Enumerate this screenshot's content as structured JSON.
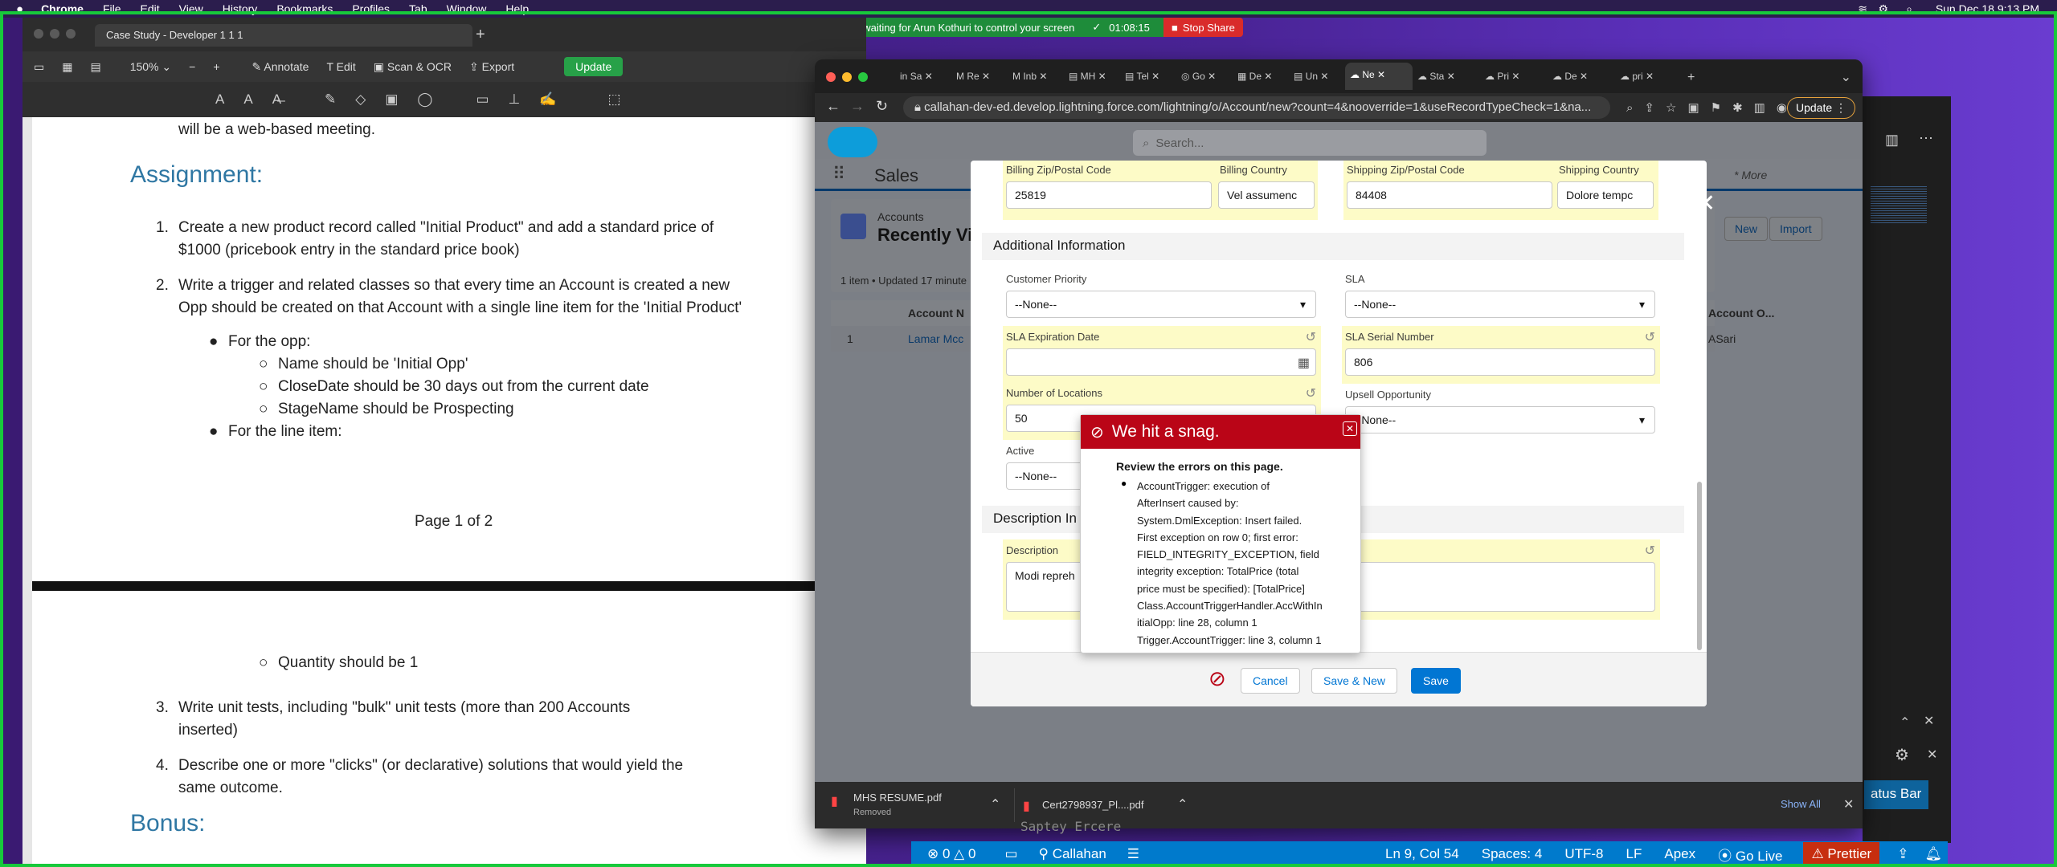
{
  "menubar": {
    "app": "Chrome",
    "items": [
      "File",
      "Edit",
      "View",
      "History",
      "Bookmarks",
      "Profiles",
      "Tab",
      "Window",
      "Help"
    ],
    "clock": "Sun Dec 18  9:13 PM"
  },
  "share": {
    "status": "waiting for Arun Kothuri to control your screen",
    "timer": "01:08:15",
    "stop": "Stop Share"
  },
  "preview": {
    "title": "Case Study - Developer 1 1 1",
    "zoom": "150%",
    "tools": {
      "annotate": "Annotate",
      "edit": "Edit",
      "scan": "Scan & OCR",
      "export": "Export",
      "update": "Update"
    },
    "doc": {
      "top_line": "will be a web-based meeting.",
      "assignment_heading": "Assignment:",
      "item1_num": "1.",
      "item1_line1": "Create a new product record called \"Initial Product\" and add a standard price of",
      "item1_line2": "$1000 (pricebook entry in the standard price book)",
      "item2_num": "2.",
      "item2_line1": "Write a trigger and related classes so that every time an Account is created a new",
      "item2_line2": "Opp should be created on that Account with a single line item for the 'Initial Product'",
      "opp_bullet": "For the opp:",
      "opp_sub1": "Name should be 'Initial Opp'",
      "opp_sub2": "CloseDate should be 30 days out from the current date",
      "opp_sub3": "StageName should be Prospecting",
      "line_bullet": "For the line item:",
      "page_label": "Page 1 of 2",
      "qty": "Quantity should be 1",
      "item3_num": "3.",
      "item3_line1": "Write unit tests, including \"bulk\" unit tests (more than 200 Accounts",
      "item3_line2": "inserted)",
      "item4_num": "4.",
      "item4_line1": "Describe one or more \"clicks\" (or declarative) solutions that would yield the",
      "item4_line2": "same outcome.",
      "bonus_heading": "Bonus:"
    }
  },
  "chrome": {
    "tabs": [
      "Sa",
      "Re",
      "Inb",
      "MH",
      "Tel",
      "Go",
      "De",
      "Un",
      "Ne",
      "Sta",
      "Pri",
      "De",
      "pri"
    ],
    "url": "callahan-dev-ed.develop.lightning.force.com/lightning/o/Account/new?count=4&nooverride=1&useRecordTypeCheck=1&na...",
    "update": "Update"
  },
  "sf": {
    "search_placeholder": "Search...",
    "app_name": "Sales",
    "more": "* More",
    "list_object": "Accounts",
    "list_title": "Recently Vie",
    "list_meta": "1 item • Updated 17 minute",
    "btn_new": "New",
    "btn_import": "Import",
    "col_account": "Account N",
    "col_owner": "Account O...",
    "row_num": "1",
    "row_account": "Lamar Mcc",
    "row_owner": "ASari"
  },
  "modal": {
    "billing_zip_label": "Billing Zip/Postal Code",
    "billing_zip": "25819",
    "billing_country_label": "Billing Country",
    "billing_country": "Vel assumenc",
    "shipping_zip_label": "Shipping Zip/Postal Code",
    "shipping_zip": "84408",
    "shipping_country_label": "Shipping Country",
    "shipping_country": "Dolore tempc",
    "section_additional": "Additional Information",
    "priority_label": "Customer Priority",
    "priority_value": "--None--",
    "sla_label": "SLA",
    "sla_value": "--None--",
    "sla_exp_label": "SLA Expiration Date",
    "sla_exp_value": "",
    "sla_serial_label": "SLA Serial Number",
    "sla_serial_value": "806",
    "locations_label": "Number of Locations",
    "locations_value": "50",
    "upsell_label": "Upsell Opportunity",
    "upsell_value": "--None--",
    "active_label": "Active",
    "active_value": "--None--",
    "section_description": "Description In",
    "description_label": "Description",
    "description_value": "Modi repreh",
    "btn_cancel": "Cancel",
    "btn_save_new": "Save & New",
    "btn_save": "Save"
  },
  "snag": {
    "title": "We hit a snag.",
    "heading": "Review the errors on this page.",
    "lines": [
      "AccountTrigger: execution of",
      "AfterInsert caused by:",
      "System.DmlException: Insert failed.",
      "First exception on row 0; first error:",
      "FIELD_INTEGRITY_EXCEPTION, field",
      "integrity exception: TotalPrice (total",
      "price must be specified): [TotalPrice]",
      "Class.AccountTriggerHandler.AccWithIn",
      "itialOpp: line 28, column 1",
      "Trigger.AccountTrigger: line 3, column 1"
    ]
  },
  "downloads": {
    "file1": "MHS RESUME.pdf",
    "file1_status": "Removed",
    "file2": "Cert2798937_Pl....pdf",
    "show_all": "Show All"
  },
  "vscode": {
    "errors": "0",
    "warnings": "0",
    "org": "Callahan",
    "position": "Ln 9, Col 54",
    "spaces": "Spaces: 4",
    "encoding": "UTF-8",
    "eol": "LF",
    "lang": "Apex",
    "golive": "Go Live",
    "prettier": "Prettier",
    "status_bar_btn": "atus Bar",
    "bg_text": "Saptey Ercere"
  }
}
